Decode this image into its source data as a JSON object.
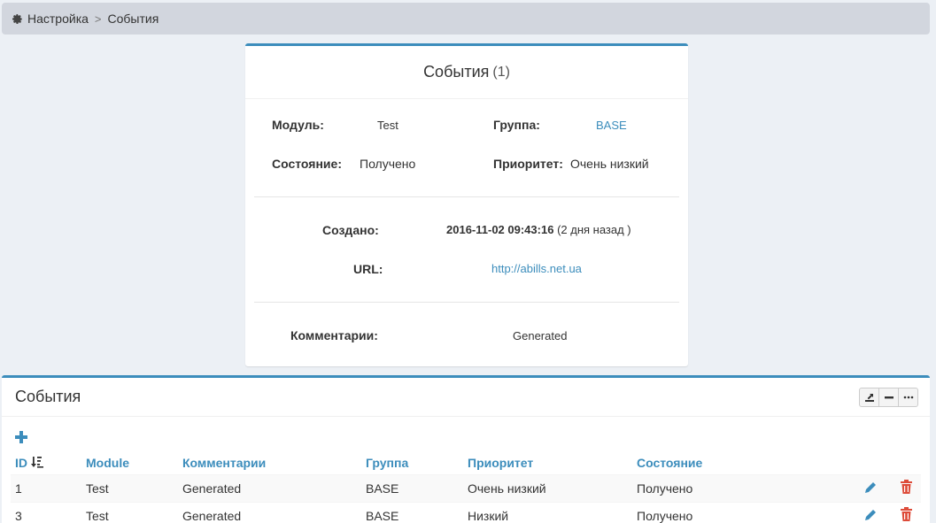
{
  "breadcrumb": {
    "items": [
      "Настройка",
      "События"
    ],
    "separator": ">"
  },
  "detail": {
    "title": "События",
    "count": "(1)",
    "module_label": "Модуль:",
    "module_value": "Test",
    "group_label": "Группа:",
    "group_value": "BASE",
    "state_label": "Состояние:",
    "state_value": "Получено",
    "priority_label": "Приоритет:",
    "priority_value": "Очень низкий",
    "created_label": "Создано:",
    "created_value": "2016-11-02 09:43:16",
    "created_ago": "(2 дня назад )",
    "url_label": "URL:",
    "url_value": "http://abills.net.ua",
    "comments_label": "Комментарии:",
    "comments_value": "Generated"
  },
  "list": {
    "title": "События",
    "columns": [
      "ID",
      "Module",
      "Комментарии",
      "Группа",
      "Приоритет",
      "Состояние"
    ],
    "rows": [
      {
        "id": "1",
        "module": "Test",
        "comments": "Generated",
        "group": "BASE",
        "priority": "Очень низкий",
        "state": "Получено"
      },
      {
        "id": "3",
        "module": "Test",
        "comments": "Generated",
        "group": "BASE",
        "priority": "Низкий",
        "state": "Получено"
      }
    ]
  },
  "icons": {
    "breadcrumb": "gear-icon",
    "export": "export-icon",
    "collapse": "minus-icon",
    "more": "ellipsis-icon",
    "add": "plus-icon",
    "sort": "sort-desc-icon",
    "edit": "pencil-icon",
    "delete": "trash-icon"
  },
  "colors": {
    "accent": "#3c8dbc",
    "danger": "#dd4b39",
    "breadcrumb_bg": "#d2d6de",
    "page_bg": "#ecf0f5"
  }
}
